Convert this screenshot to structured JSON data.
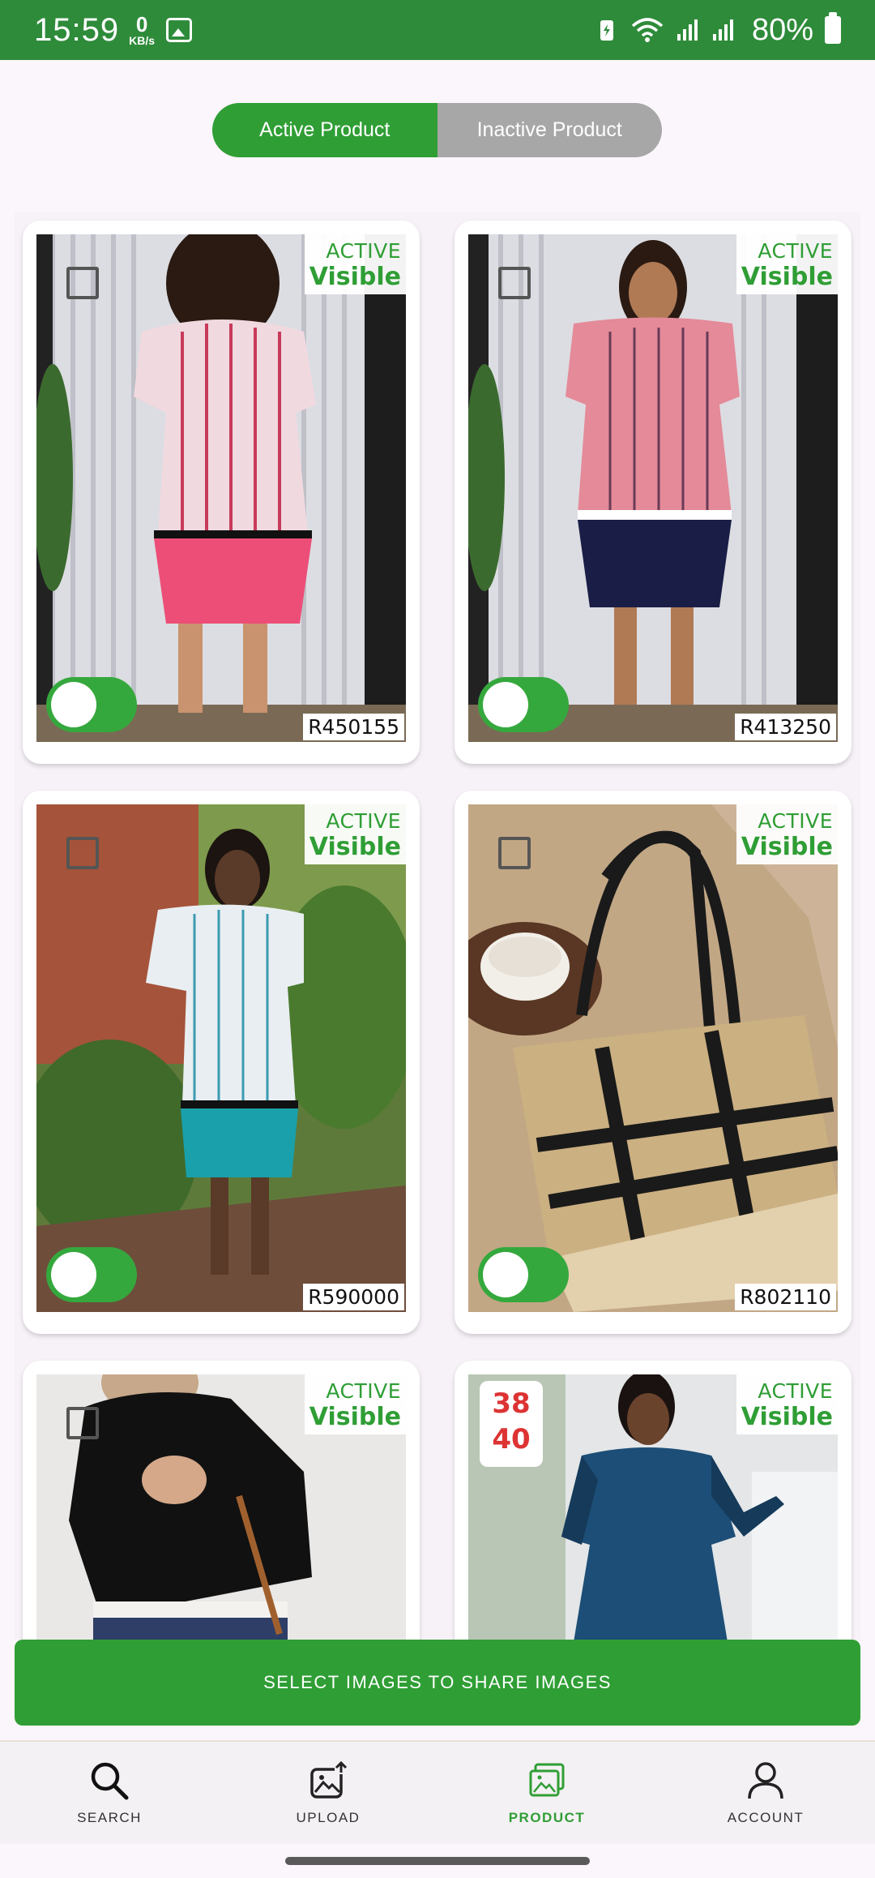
{
  "status_bar": {
    "time": "15:59",
    "net_speed_value": "0",
    "net_speed_unit": "KB/s",
    "battery_percent": "80%"
  },
  "segmented": {
    "active_label": "Active Product",
    "inactive_label": "Inactive Product"
  },
  "products": [
    {
      "status": "ACTIVE",
      "visibility": "Visible",
      "sku": "R450155",
      "toggle_on": true
    },
    {
      "status": "ACTIVE",
      "visibility": "Visible",
      "sku": "R413250",
      "toggle_on": true
    },
    {
      "status": "ACTIVE",
      "visibility": "Visible",
      "sku": "R590000",
      "toggle_on": true
    },
    {
      "status": "ACTIVE",
      "visibility": "Visible",
      "sku": "R802110",
      "toggle_on": true
    },
    {
      "status": "ACTIVE",
      "visibility": "Visible"
    },
    {
      "status": "ACTIVE",
      "visibility": "Visible",
      "size_badge": [
        "38",
        "40"
      ]
    }
  ],
  "share_button_label": "SELECT IMAGES TO SHARE IMAGES",
  "bottom_nav": {
    "search": "SEARCH",
    "upload": "UPLOAD",
    "product": "PRODUCT",
    "account": "ACCOUNT"
  },
  "colors": {
    "brand_green": "#2f9e35",
    "status_bar": "#2e8b3a",
    "inactive_gray": "#a7a7a7"
  }
}
